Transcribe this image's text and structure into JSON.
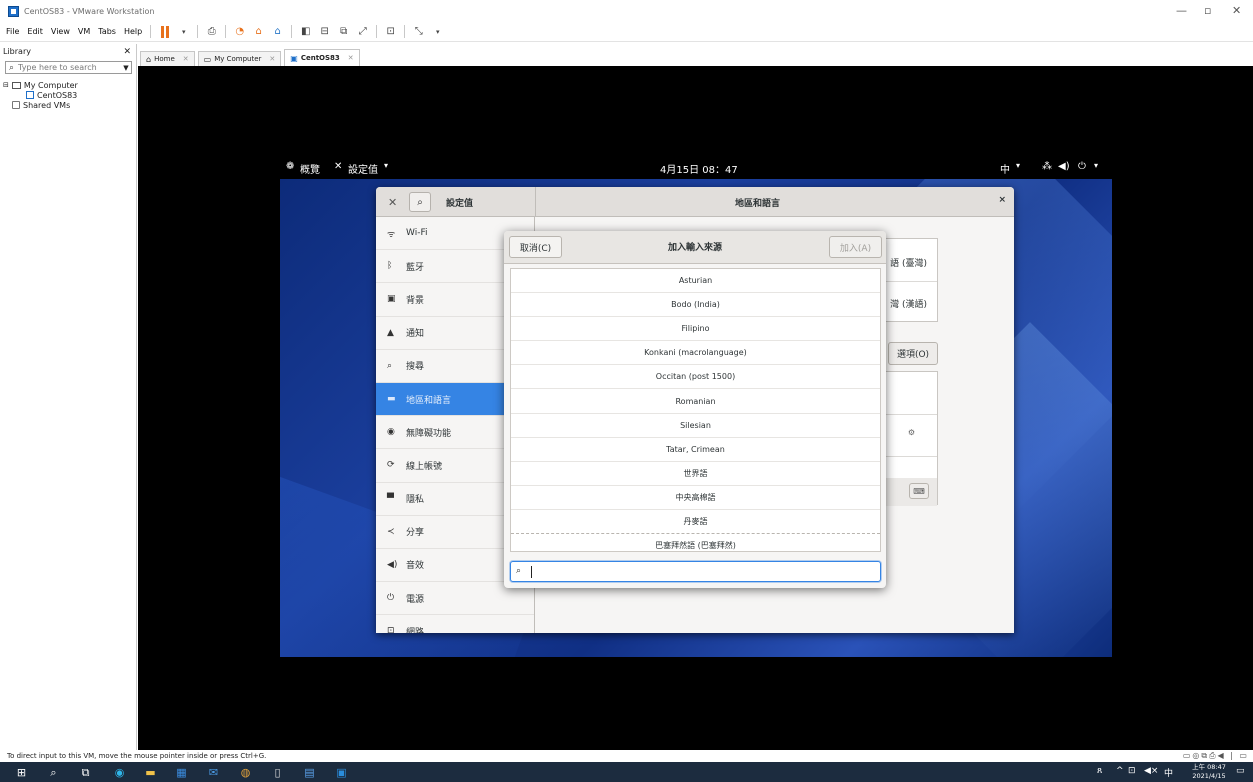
{
  "window": {
    "title": "CentOS83 - VMware Workstation"
  },
  "menubar": {
    "items": [
      "File",
      "Edit",
      "View",
      "VM",
      "Tabs",
      "Help"
    ]
  },
  "library": {
    "title": "Library",
    "search_placeholder": "Type here to search",
    "tree": {
      "my_computer": "My Computer",
      "vm": "CentOS83",
      "shared": "Shared VMs"
    }
  },
  "tabs": [
    {
      "label": "Home"
    },
    {
      "label": "My Computer"
    },
    {
      "label": "CentOS83"
    }
  ],
  "gnome_bar": {
    "activities": "概覽",
    "app_menu": "設定值",
    "clock": "4月15日 08：47",
    "input_method": "中"
  },
  "settings": {
    "left_title": "設定值",
    "right_title": "地區和語言",
    "close": "×",
    "sidebar": [
      {
        "label": "Wi-Fi",
        "icon": "wifi-icon"
      },
      {
        "label": "藍牙",
        "icon": "bluetooth-icon"
      },
      {
        "label": "背景",
        "icon": "background-icon"
      },
      {
        "label": "通知",
        "icon": "bell-icon"
      },
      {
        "label": "搜尋",
        "icon": "search-icon"
      },
      {
        "label": "地區和語言",
        "icon": "flag-icon",
        "selected": true
      },
      {
        "label": "無障礙功能",
        "icon": "accessibility-icon"
      },
      {
        "label": "線上帳號",
        "icon": "online-accounts-icon"
      },
      {
        "label": "隱私",
        "icon": "privacy-icon"
      },
      {
        "label": "分享",
        "icon": "share-icon"
      },
      {
        "label": "音效",
        "icon": "speaker-icon"
      },
      {
        "label": "電源",
        "icon": "power-icon"
      },
      {
        "label": "網路",
        "icon": "network-icon"
      }
    ],
    "content": {
      "language_value": "語 (臺灣)",
      "formats_value": "灣 (漢語)",
      "options_button": "選項(O)"
    }
  },
  "dialog": {
    "cancel": "取消(C)",
    "title": "加入輸入來源",
    "add": "加入(A)",
    "languages": [
      "Asturian",
      "Bodo (India)",
      "Filipino",
      "Konkani (macrolanguage)",
      "Occitan (post 1500)",
      "Romanian",
      "Silesian",
      "Tatar, Crimean",
      "世界語",
      "中央高棉語",
      "丹麥語",
      "巴塞拜然語 (巴塞拜然)"
    ],
    "search_value": ""
  },
  "statusbar": {
    "text": "To direct input to this VM, move the mouse pointer inside or press Ctrl+G."
  },
  "taskbar": {
    "time": "上午 08:47",
    "date": "2021/4/15",
    "ime": "中"
  }
}
